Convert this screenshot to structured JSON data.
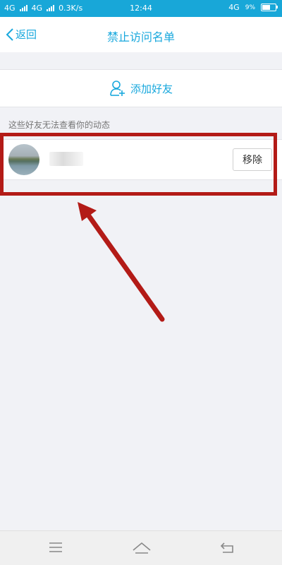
{
  "status_bar": {
    "network_1": "4G",
    "network_2": "4G",
    "speed": "0.3K/s",
    "time": "12:44",
    "network_right": "4G",
    "battery_text": "9%",
    "battery_level": 0.6
  },
  "header": {
    "back_label": "返回",
    "title": "禁止访问名单"
  },
  "add_friend": {
    "label": "添加好友"
  },
  "section": {
    "caption": "这些好友无法查看你的动态"
  },
  "friends": [
    {
      "remove_label": "移除"
    }
  ],
  "colors": {
    "accent": "#19a8dd",
    "highlight": "#b31b17",
    "background": "#f1f2f6"
  }
}
